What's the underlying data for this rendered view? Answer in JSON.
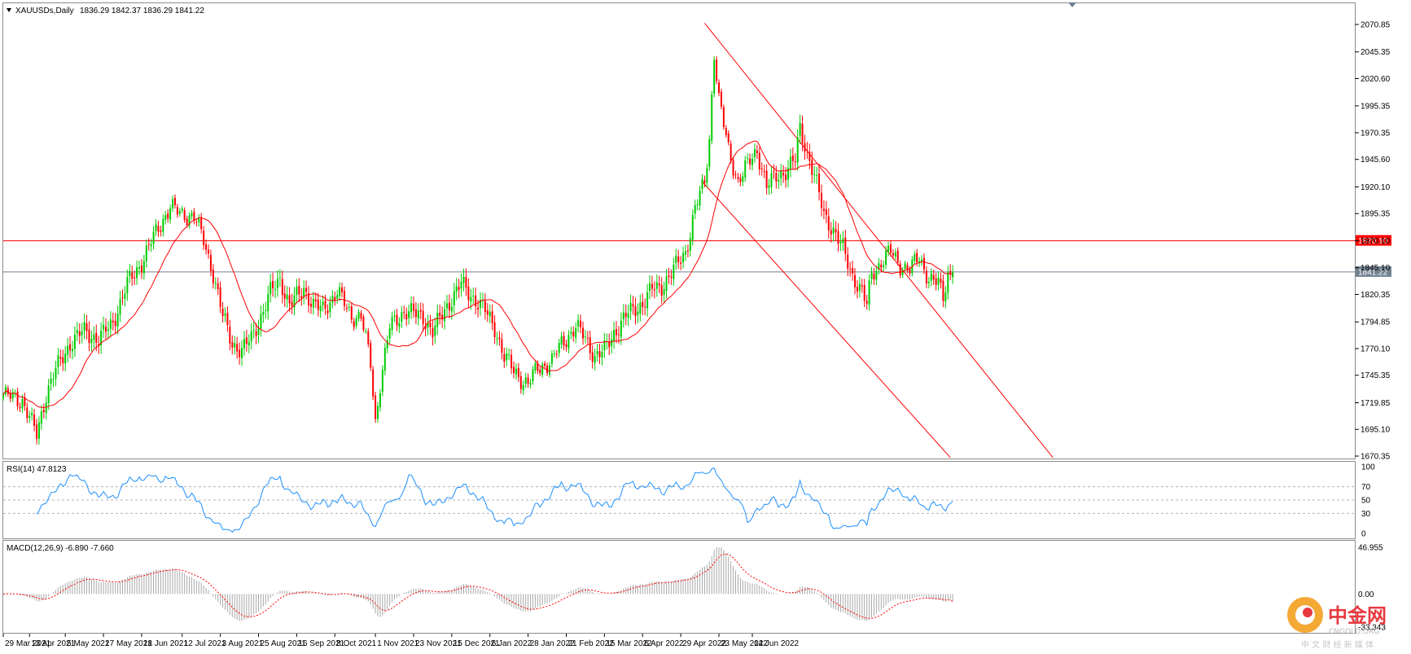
{
  "header": {
    "symbol_text": "XAUUSDs,Daily",
    "ohlc_text": "1836.29 1842.37 1836.29 1841.22"
  },
  "chart_data": [
    {
      "type": "candlestick",
      "title": "XAUUSDs,Daily",
      "ylim": [
        1670.35,
        2083.0
      ],
      "y_ticks": [
        "2070.85",
        "2045.35",
        "2020.60",
        "1995.35",
        "1970.35",
        "1945.60",
        "1920.10",
        "1895.35",
        "1870.10",
        "1845.10",
        "1820.35",
        "1794.85",
        "1770.10",
        "1745.35",
        "1719.85",
        "1695.10",
        "1670.35"
      ],
      "x_ticks": [
        "29 Mar 2021",
        "13 Apr 2021",
        "5 May 2021",
        "27 May 2021",
        "18 Jun 2021",
        "12 Jul 2021",
        "3 Aug 2021",
        "25 Aug 2021",
        "16 Sep 2021",
        "8 Oct 2021",
        "1 Nov 2021",
        "23 Nov 2021",
        "15 Dec 2021",
        "6 Jan 2022",
        "28 Jan 2022",
        "21 Feb 2022",
        "15 Mar 2022",
        "6 Apr 2022",
        "29 Apr 2022",
        "23 May 2022",
        "14 Jun 2022"
      ],
      "horizontal_lines": [
        {
          "label": "1870.10",
          "value": 1870.1,
          "color": "#ff0000"
        },
        {
          "label": "1841.22",
          "value": 1841.22,
          "color": "#708090"
        }
      ],
      "moving_average_color": "#ff0000",
      "bull_color": "#00cc00",
      "bear_color": "#ff0000",
      "trend_channel": {
        "upper": {
          "from_bar": 294,
          "from_value": 2072.0,
          "to_bar": 440,
          "to_value": 1669.0
        },
        "lower": {
          "from_bar": 293,
          "from_value": 1925.0,
          "to_bar": 397,
          "to_value": 1669.0
        },
        "color": "#ff0000"
      },
      "close_path": [
        [
          0,
          1727
        ],
        [
          8,
          1722
        ],
        [
          14,
          1690
        ],
        [
          18,
          1728
        ],
        [
          22,
          1750
        ],
        [
          28,
          1775
        ],
        [
          34,
          1787
        ],
        [
          40,
          1778
        ],
        [
          46,
          1795
        ],
        [
          52,
          1830
        ],
        [
          58,
          1850
        ],
        [
          64,
          1878
        ],
        [
          70,
          1902
        ],
        [
          74,
          1895
        ],
        [
          80,
          1893
        ],
        [
          84,
          1870
        ],
        [
          88,
          1840
        ],
        [
          92,
          1800
        ],
        [
          96,
          1775
        ],
        [
          100,
          1768
        ],
        [
          104,
          1780
        ],
        [
          108,
          1800
        ],
        [
          112,
          1822
        ],
        [
          116,
          1835
        ],
        [
          120,
          1810
        ],
        [
          126,
          1826
        ],
        [
          130,
          1810
        ],
        [
          134,
          1806
        ],
        [
          140,
          1823
        ],
        [
          146,
          1800
        ],
        [
          150,
          1800
        ],
        [
          154,
          1756
        ],
        [
          156,
          1702
        ],
        [
          158,
          1738
        ],
        [
          162,
          1790
        ],
        [
          168,
          1805
        ],
        [
          176,
          1800
        ],
        [
          180,
          1785
        ],
        [
          186,
          1810
        ],
        [
          192,
          1830
        ],
        [
          198,
          1815
        ],
        [
          202,
          1805
        ],
        [
          206,
          1790
        ],
        [
          210,
          1762
        ],
        [
          214,
          1750
        ],
        [
          218,
          1740
        ],
        [
          220,
          1737
        ],
        [
          224,
          1752
        ],
        [
          230,
          1758
        ],
        [
          234,
          1775
        ],
        [
          240,
          1790
        ],
        [
          244,
          1780
        ],
        [
          248,
          1763
        ],
        [
          252,
          1768
        ],
        [
          256,
          1785
        ],
        [
          262,
          1803
        ],
        [
          268,
          1812
        ],
        [
          272,
          1825
        ],
        [
          276,
          1828
        ],
        [
          280,
          1840
        ],
        [
          286,
          1860
        ],
        [
          288,
          1878
        ],
        [
          290,
          1900
        ],
        [
          294,
          1925
        ],
        [
          296,
          1965
        ],
        [
          298,
          2045
        ],
        [
          300,
          2000
        ],
        [
          304,
          1955
        ],
        [
          308,
          1925
        ],
        [
          312,
          1940
        ],
        [
          316,
          1955
        ],
        [
          320,
          1920
        ],
        [
          324,
          1930
        ],
        [
          328,
          1935
        ],
        [
          332,
          1945
        ],
        [
          334,
          1975
        ],
        [
          336,
          1960
        ],
        [
          340,
          1930
        ],
        [
          344,
          1895
        ],
        [
          348,
          1880
        ],
        [
          352,
          1862
        ],
        [
          356,
          1838
        ],
        [
          360,
          1822
        ],
        [
          362,
          1810
        ],
        [
          364,
          1840
        ],
        [
          368,
          1850
        ],
        [
          372,
          1860
        ],
        [
          376,
          1848
        ],
        [
          380,
          1843
        ],
        [
          384,
          1855
        ],
        [
          388,
          1835
        ],
        [
          392,
          1830
        ],
        [
          394,
          1818
        ],
        [
          396,
          1840
        ],
        [
          398,
          1841
        ]
      ],
      "rsi": {
        "label": "RSI(14) 47.8123",
        "value": 47.8123,
        "levels": [
          70,
          50,
          30
        ],
        "ticks": [
          "100",
          "70",
          "50",
          "30",
          "0"
        ],
        "color": "#1e90ff"
      },
      "macd": {
        "label": "MACD(12,26,9) -6.890 -7.660",
        "main": -6.89,
        "signal": -7.66,
        "ticks": [
          "46.955",
          "0.00",
          "-33.343"
        ],
        "ylim": [
          -33.343,
          46.955
        ],
        "histogram_color": "#a9a9a9",
        "signal_color": "#ff0000"
      }
    }
  ],
  "watermark": {
    "brand": "中金网",
    "domain": "CNGOLD.ORG",
    "slogan": "中 文 财 经 新 媒 体"
  }
}
